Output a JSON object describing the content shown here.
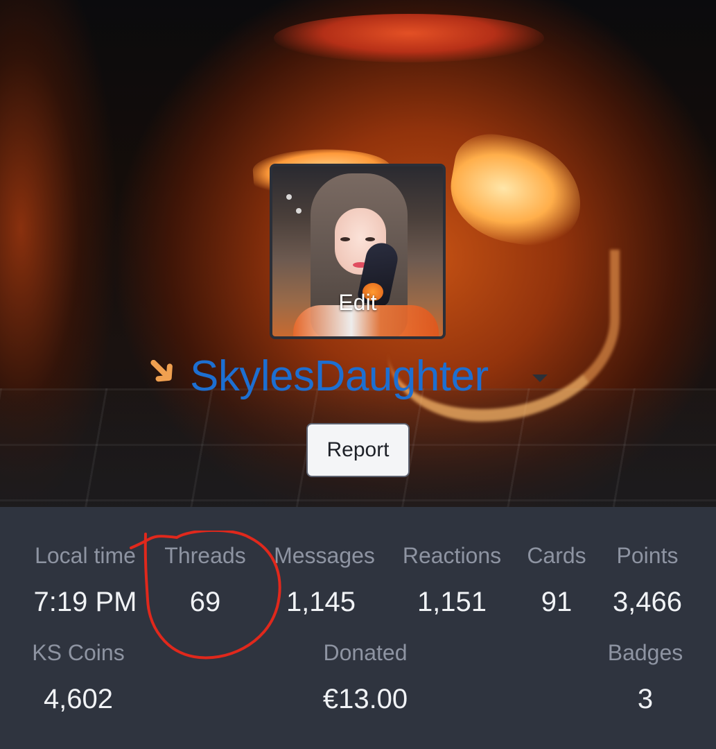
{
  "profile": {
    "avatar_action": "Edit",
    "username": "SkylesDaughter",
    "report_label": "Report",
    "username_color": "#1d6fd1"
  },
  "stats_row1": [
    {
      "label": "Local time",
      "value": "7:19 PM"
    },
    {
      "label": "Threads",
      "value": "69"
    },
    {
      "label": "Messages",
      "value": "1,145"
    },
    {
      "label": "Reactions",
      "value": "1,151"
    },
    {
      "label": "Cards",
      "value": "91"
    },
    {
      "label": "Points",
      "value": "3,466"
    }
  ],
  "stats_row2": [
    {
      "label": "KS Coins",
      "value": "4,602"
    },
    {
      "label": "Donated",
      "value": "€13.00"
    },
    {
      "label": "Badges",
      "value": "3"
    }
  ],
  "annotations": {
    "arrow_color": "#f0a050",
    "circle_color": "#e0281c"
  }
}
